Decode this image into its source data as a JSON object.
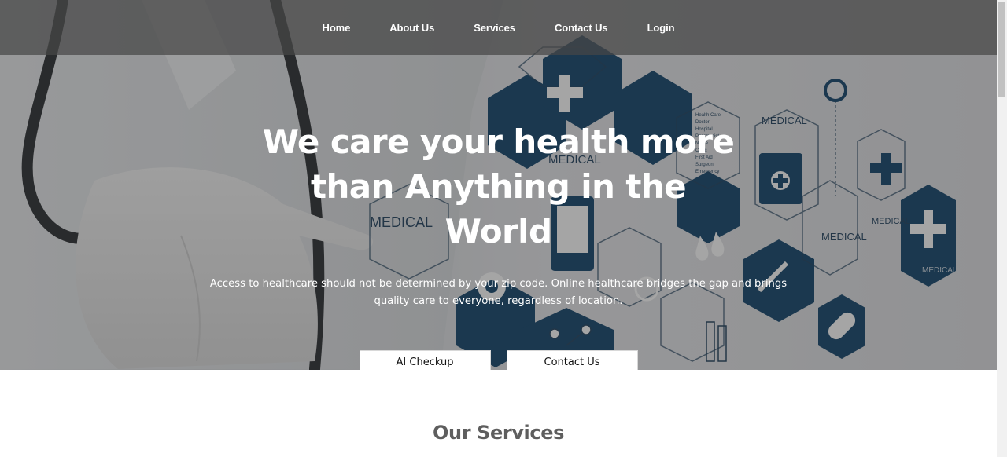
{
  "nav": {
    "items": [
      {
        "label": "Home"
      },
      {
        "label": "About Us"
      },
      {
        "label": "Services"
      },
      {
        "label": "Contact Us"
      },
      {
        "label": "Login"
      }
    ]
  },
  "hero": {
    "title": "We care your health more than Anything in the World",
    "subtitle": "Access to healthcare should not be determined by your zip code. Online healthcare bridges the gap and brings quality care to everyone, regardless of location.",
    "primary_button": "AI Checkup",
    "secondary_button": "Contact Us",
    "bg_labels": {
      "medical": "MEDICAL",
      "list": [
        "Health Care",
        "Doctor",
        "Hospital",
        "Pharmacist",
        "Nurse",
        "Clinic",
        "Stimulus",
        "First Aid",
        "Surgeon",
        "Emergency"
      ]
    }
  },
  "services": {
    "title": "Our Services"
  },
  "colors": {
    "hex_blue": "#12446b",
    "overlay": "#464646",
    "button_bg": "#ffffff",
    "section_title": "#5e5e5e"
  }
}
